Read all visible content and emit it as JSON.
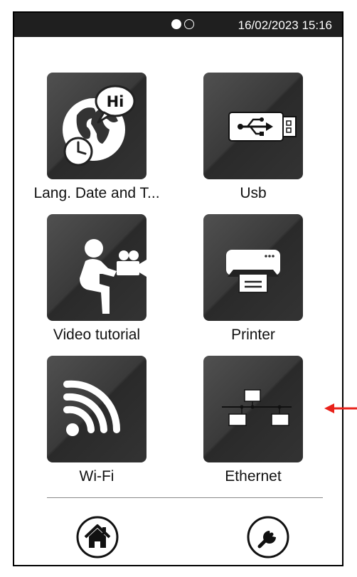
{
  "status_bar": {
    "page_indicator": {
      "pages": 2,
      "current": 1
    },
    "datetime": "16/02/2023 15:16"
  },
  "tiles": [
    {
      "label": "Lang. Date and T...",
      "icon": "globe-speech-clock-icon",
      "bubble_text": "Hi"
    },
    {
      "label": "Usb",
      "icon": "usb-icon"
    },
    {
      "label": "Video tutorial",
      "icon": "person-camera-icon"
    },
    {
      "label": "Printer",
      "icon": "printer-icon"
    },
    {
      "label": "Wi-Fi",
      "icon": "wifi-icon"
    },
    {
      "label": "Ethernet",
      "icon": "ethernet-network-icon"
    }
  ],
  "bottom_nav": {
    "home": {
      "icon": "home-icon"
    },
    "tools": {
      "icon": "wrench-icon"
    }
  },
  "annotation": {
    "icon": "red-arrow-icon",
    "color": "#e8211a"
  },
  "colors": {
    "tile_dark": "#2a2a2a",
    "status_bar": "#1f1f1f"
  }
}
